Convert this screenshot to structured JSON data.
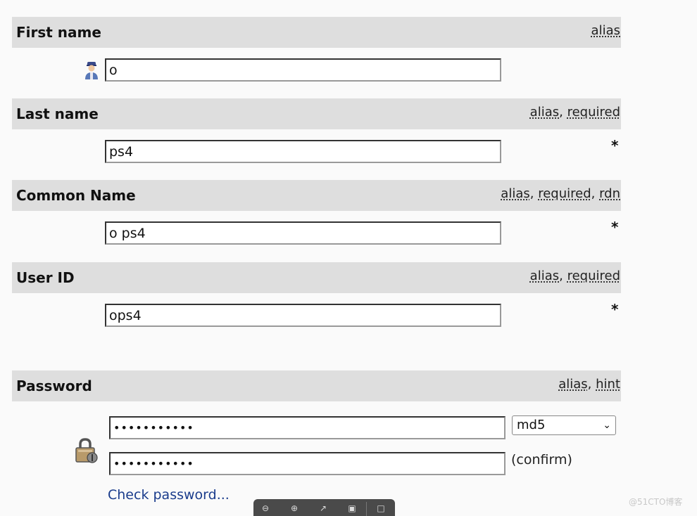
{
  "fields": {
    "first_name": {
      "title": "First name",
      "links": [
        "alias"
      ],
      "value": "o"
    },
    "last_name": {
      "title": "Last name",
      "links": [
        "alias",
        "required"
      ],
      "value": "ps4",
      "required_mark": "*"
    },
    "common_name": {
      "title": "Common Name",
      "links": [
        "alias",
        "required",
        "rdn"
      ],
      "value": "o ps4",
      "required_mark": "*"
    },
    "user_id": {
      "title": "User ID",
      "links": [
        "alias",
        "required"
      ],
      "value": "ops4",
      "required_mark": "*"
    },
    "password": {
      "title": "Password",
      "links": [
        "alias",
        "hint"
      ],
      "value": "•••••••••••",
      "confirm_value": "•••••••••••",
      "hash_selected": "md5",
      "confirm_label": "(confirm)",
      "check_link": "Check password..."
    }
  },
  "icons": {
    "person": "person-icon",
    "lock": "padlock-icon"
  },
  "watermark": "@51CTO博客"
}
